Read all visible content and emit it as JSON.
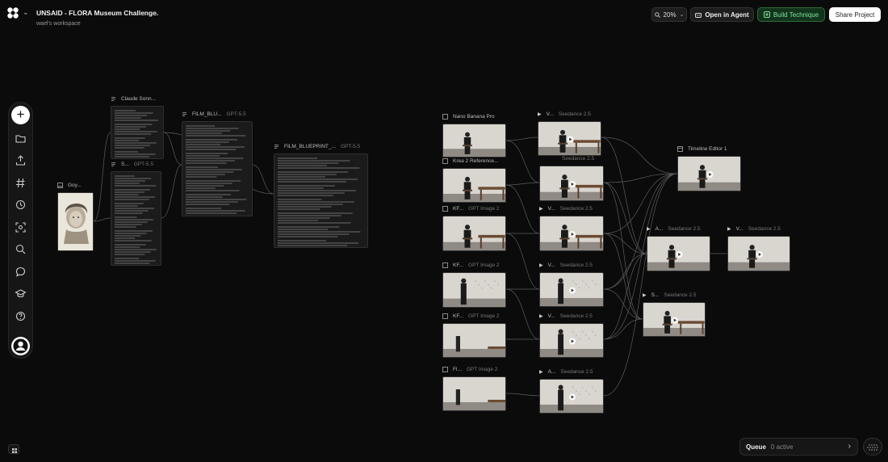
{
  "header": {
    "title": "UNSAID - FLORA Museum Challenge.",
    "workspace": "wael's workspace",
    "zoom": "20%",
    "open_agent": "Open in Agent",
    "build_technique": "Build Technique",
    "share": "Share Project"
  },
  "nodes": {
    "portrait": {
      "title": "Goy..."
    },
    "claude": {
      "title": "Claude Sonn..."
    },
    "s1": {
      "title": "S...",
      "model": "GPT-5.5"
    },
    "film1": {
      "title": "FILM_BLU...",
      "model": "GPT-5.5"
    },
    "film2": {
      "title": "FILM_BLUEPRINT_...",
      "model": "GPT-5.5"
    },
    "nano": {
      "title": "Nano Banana Pro"
    },
    "v1": {
      "title": "V...",
      "model": "Seedance 2.5"
    },
    "krea": {
      "title": "Krea 2 Reference..."
    },
    "v2": {
      "title": "",
      "model": "Seedance 2.5"
    },
    "kf1": {
      "title": "KF...",
      "model": "GPT Image 2"
    },
    "v3": {
      "title": "V...",
      "model": "Seedance 2.5"
    },
    "kf2": {
      "title": "KF...",
      "model": "GPT Image 2"
    },
    "v4": {
      "title": "V...",
      "model": "Seedance 2.5"
    },
    "kf3": {
      "title": "KF...",
      "model": "GPT Image 2"
    },
    "v5": {
      "title": "V...",
      "model": "Seedance 2.5"
    },
    "fl": {
      "title": "Fl...",
      "model": "GPT Image 2"
    },
    "a1": {
      "title": "A...",
      "model": "Seedance 2.5"
    },
    "timeline": {
      "title": "Timeline Editor 1"
    },
    "a2": {
      "title": "A...",
      "model": "Seedance 2.5"
    },
    "v6": {
      "title": "V...",
      "model": "Seedance 2.5"
    },
    "s2": {
      "title": "S...",
      "model": "Seedance 2.5"
    }
  },
  "queue": {
    "label": "Queue",
    "count": "0 active"
  },
  "toolbar_icons": [
    "add-icon",
    "folder-icon",
    "upload-icon",
    "hashtag-icon",
    "history-icon",
    "scan-icon",
    "search-icon",
    "chat-icon",
    "graduation-cap-icon",
    "help-icon",
    "avatar"
  ],
  "colors": {
    "accent_green": "#7fe29a",
    "canvas_bg": "#0b0b0b"
  }
}
